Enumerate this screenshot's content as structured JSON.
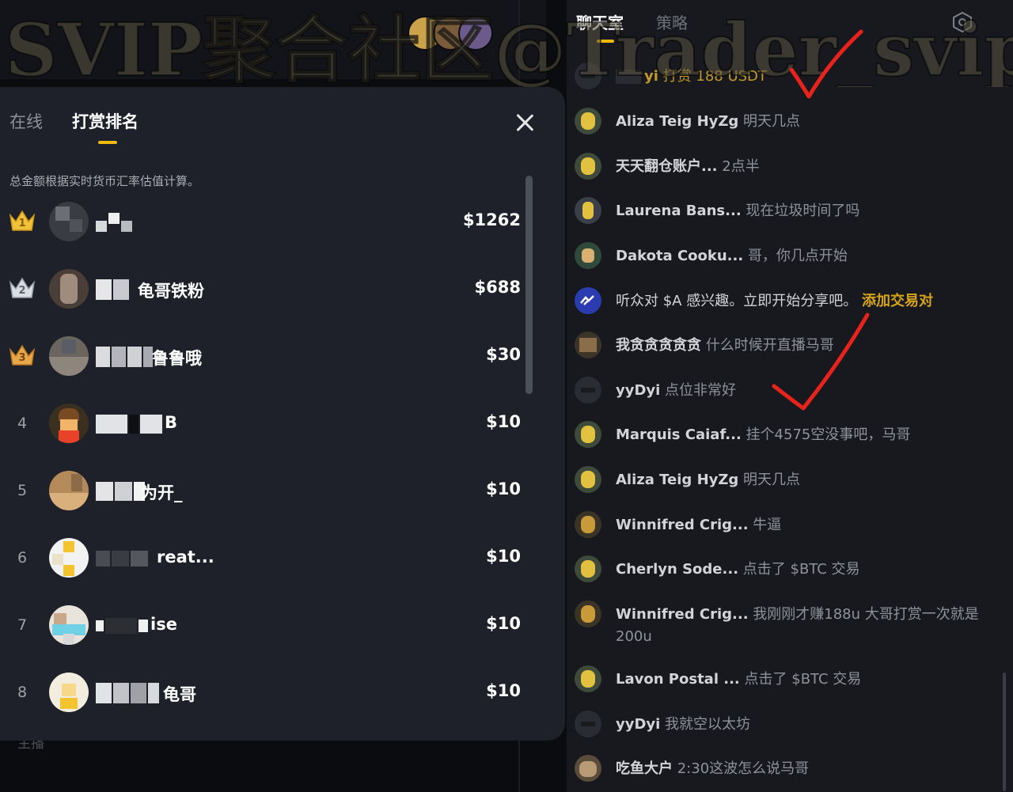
{
  "watermark": "SVIP聚合社区@Trader_svip",
  "background": {
    "bottom_label": "主播"
  },
  "leaderboard": {
    "tabs": [
      "在线",
      "打赏排名"
    ],
    "active_tab": "打赏排名",
    "note": "总金额根据实时货币汇率估值计算。",
    "rows": [
      {
        "rank": "1",
        "name": "",
        "amount": "$1262",
        "crown": "gold"
      },
      {
        "rank": "2",
        "name": "龟哥铁粉",
        "amount": "$688",
        "crown": "silver"
      },
      {
        "rank": "3",
        "name": "鲁鲁哦",
        "amount": "$30",
        "crown": "bronze"
      },
      {
        "rank": "4",
        "name": "B",
        "amount": "$10"
      },
      {
        "rank": "5",
        "name": "为开_",
        "amount": "$10"
      },
      {
        "rank": "6",
        "name": "reat...",
        "amount": "$10"
      },
      {
        "rank": "7",
        "name": "ise",
        "amount": "$10"
      },
      {
        "rank": "8",
        "name": "龟哥",
        "amount": "$10"
      }
    ]
  },
  "chat": {
    "tabs": [
      "聊天室",
      "策略"
    ],
    "active_tab": "聊天室",
    "messages": [
      {
        "user": "yi",
        "text": "打赏 188 USDT",
        "style": "tip"
      },
      {
        "user": "Aliza Teig HyZg",
        "text": "明天几点"
      },
      {
        "user": "天天翻仓账户...",
        "text": "2点半"
      },
      {
        "user": "Laurena Bans...",
        "text": "现在垃圾时间了吗"
      },
      {
        "user": "Dakota Cooku...",
        "text": "哥，你几点开始"
      },
      {
        "user": "",
        "text": "听众对 $A 感兴趣。立即开始分享吧。",
        "link": "添加交易对",
        "style": "system"
      },
      {
        "user": "我贪贪贪贪贪",
        "text": "什么时候开直播马哥"
      },
      {
        "user": "yyDyi",
        "text": "点位非常好"
      },
      {
        "user": "Marquis Caiaf...",
        "text": "挂个4575空没事吧，马哥"
      },
      {
        "user": "Aliza Teig HyZg",
        "text": "明天几点"
      },
      {
        "user": "Winnifred Crig...",
        "text": "牛逼"
      },
      {
        "user": "Cherlyn Sode...",
        "text": "点击了 $BTC 交易"
      },
      {
        "user": "Winnifred Crig...",
        "text": "我刚刚才赚188u 大哥打赏一次就是200u"
      },
      {
        "user": "Lavon Postal ...",
        "text": "点击了 $BTC 交易"
      },
      {
        "user": "yyDyi",
        "text": "我就空以太坊"
      },
      {
        "user": "吃鱼大户",
        "text": "2:30这波怎么说马哥"
      }
    ]
  },
  "colors": {
    "gold": "#f0b90b",
    "panel": "#1e2129",
    "chat_bg": "#17191f",
    "check": "#e8231c"
  }
}
